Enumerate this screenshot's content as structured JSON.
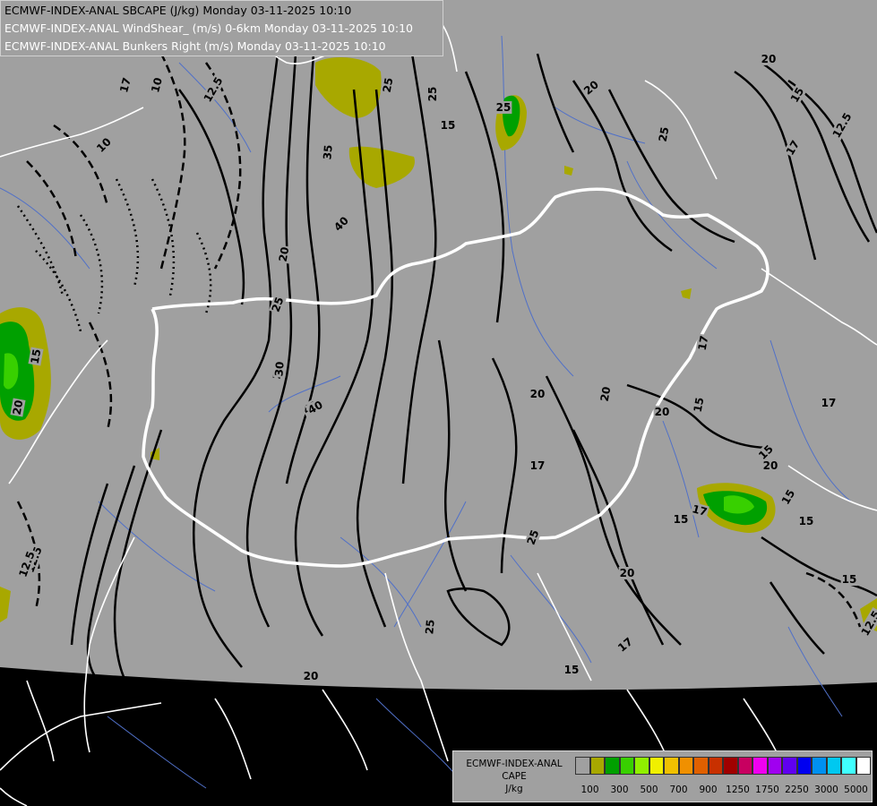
{
  "title": {
    "main": "ECMWF-INDEX-ANAL SBCAPE (J/kg) Monday 03-11-2025 10:10",
    "line2": "ECMWF-INDEX-ANAL WindShear_ (m/s) 0-6km Monday 03-11-2025 10:10",
    "line3": "ECMWF-INDEX-ANAL Bunkers Right (m/s) Monday 03-11-2025 10:10"
  },
  "legend": {
    "line1": "ECMWF-INDEX-ANAL",
    "line2": "CAPE",
    "line3": "J/kg",
    "colors": [
      "#a0a0a0",
      "#a8a800",
      "#00a000",
      "#38d000",
      "#90f000",
      "#f0f000",
      "#f0c000",
      "#f09000",
      "#e06000",
      "#c83000",
      "#a00000",
      "#c80060",
      "#f000f0",
      "#a000f0",
      "#6000f0",
      "#0000f0",
      "#0090f0",
      "#00c8f0",
      "#40ffff",
      "#ffffff"
    ],
    "tick_labels": [
      "100",
      "300",
      "500",
      "700",
      "900",
      "1250",
      "1750",
      "2250",
      "3000",
      "5000"
    ]
  },
  "contour_labels": [
    "12.5",
    "10",
    "12.5",
    "17",
    "25",
    "25",
    "20",
    "25",
    "20",
    "17",
    "15",
    "12.5",
    "35",
    "10",
    "40",
    "40",
    "20",
    "25",
    "20",
    "25",
    "30",
    "40",
    "20",
    "20",
    "17",
    "25",
    "15",
    "17",
    "15",
    "15",
    "12.5",
    "25",
    "17",
    "20",
    "15",
    "17",
    "20",
    "20",
    "20",
    "17",
    "15",
    "15",
    "20",
    "15",
    "15",
    "15",
    "12.5"
  ],
  "colors": {
    "map_gray": "#a0a0a0",
    "cape_low": "#a8a800",
    "cape_mid": "#00a000",
    "cape_high": "#38d000",
    "border": "#ffffff",
    "river": "#5070c8",
    "contour": "#000000"
  }
}
